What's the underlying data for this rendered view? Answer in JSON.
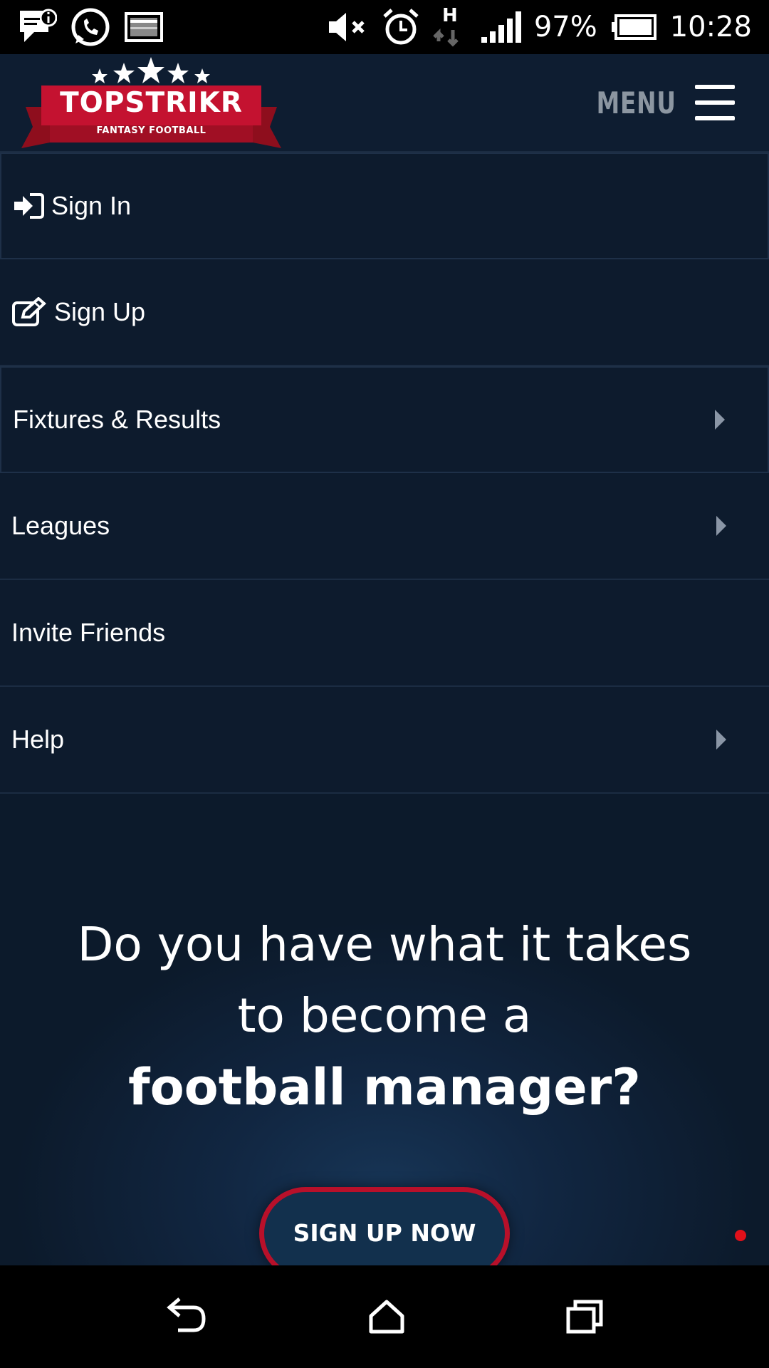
{
  "status_bar": {
    "battery": "97%",
    "time": "10:28",
    "network_type": "H",
    "icons": [
      "message-notification-icon",
      "whatsapp-icon",
      "image-icon",
      "mute-icon",
      "alarm-icon",
      "data-arrows-icon",
      "signal-icon",
      "battery-icon"
    ]
  },
  "header": {
    "logo_text": "TOPSTRIKR",
    "logo_subtitle": "FANTASY FOOTBALL",
    "menu_label": "MENU"
  },
  "nav": {
    "items": [
      {
        "label": "Sign In",
        "icon": "sign-in-icon",
        "has_submenu": false
      },
      {
        "label": "Sign Up",
        "icon": "edit-icon",
        "has_submenu": false
      },
      {
        "label": "Fixtures & Results",
        "icon": null,
        "has_submenu": true
      },
      {
        "label": "Leagues",
        "icon": null,
        "has_submenu": true
      },
      {
        "label": "Invite Friends",
        "icon": null,
        "has_submenu": false
      },
      {
        "label": "Help",
        "icon": null,
        "has_submenu": true
      }
    ]
  },
  "hero": {
    "line1": "Do you have what it takes",
    "line2": "to become a",
    "line3": "football manager?",
    "cta_label": "SIGN UP NOW"
  },
  "colors": {
    "background": "#0c1a2b",
    "accent_red": "#b8102a",
    "menu_label": "#8c96a1"
  }
}
